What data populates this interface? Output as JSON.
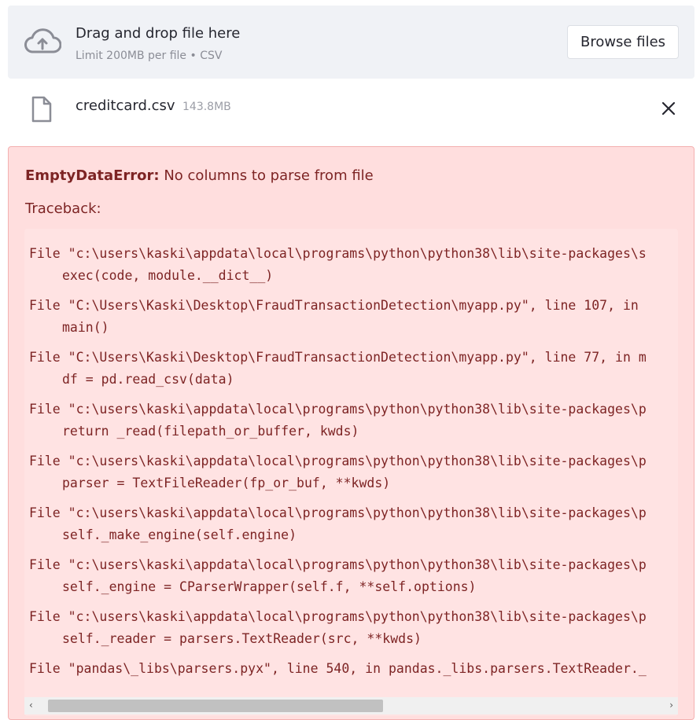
{
  "uploader": {
    "title": "Drag and drop file here",
    "limit": "Limit 200MB per file • CSV",
    "browse_label": "Browse files",
    "icon": "cloud-upload-icon"
  },
  "file": {
    "name": "creditcard.csv",
    "size": "143.8MB",
    "icon": "file-icon"
  },
  "error": {
    "type": "EmptyDataError:",
    "message": " No columns to parse from file",
    "traceback_label": "Traceback:",
    "frames": [
      {
        "file": "File \"c:\\users\\kaski\\appdata\\local\\programs\\python\\python38\\lib\\site-packages\\s",
        "code": "exec(code, module.__dict__)"
      },
      {
        "file": "File \"C:\\Users\\Kaski\\Desktop\\FraudTransactionDetection\\myapp.py\", line 107, in",
        "code": "main()"
      },
      {
        "file": "File \"C:\\Users\\Kaski\\Desktop\\FraudTransactionDetection\\myapp.py\", line 77, in m",
        "code": "df = pd.read_csv(data)"
      },
      {
        "file": "File \"c:\\users\\kaski\\appdata\\local\\programs\\python\\python38\\lib\\site-packages\\p",
        "code": "return _read(filepath_or_buffer, kwds)"
      },
      {
        "file": "File \"c:\\users\\kaski\\appdata\\local\\programs\\python\\python38\\lib\\site-packages\\p",
        "code": "parser = TextFileReader(fp_or_buf, **kwds)"
      },
      {
        "file": "File \"c:\\users\\kaski\\appdata\\local\\programs\\python\\python38\\lib\\site-packages\\p",
        "code": "self._make_engine(self.engine)"
      },
      {
        "file": "File \"c:\\users\\kaski\\appdata\\local\\programs\\python\\python38\\lib\\site-packages\\p",
        "code": "self._engine = CParserWrapper(self.f, **self.options)"
      },
      {
        "file": "File \"c:\\users\\kaski\\appdata\\local\\programs\\python\\python38\\lib\\site-packages\\p",
        "code": "self._reader = parsers.TextReader(src, **kwds)"
      },
      {
        "file": "File \"pandas\\_libs\\parsers.pyx\", line 540, in pandas._libs.parsers.TextReader._",
        "code": ""
      }
    ]
  },
  "scrollbar": {
    "left_arrow": "‹",
    "right_arrow": "›"
  },
  "colors": {
    "error_bg": "#ffdede",
    "error_text": "#7d2424",
    "dropzone_bg": "#f0f2f6"
  }
}
